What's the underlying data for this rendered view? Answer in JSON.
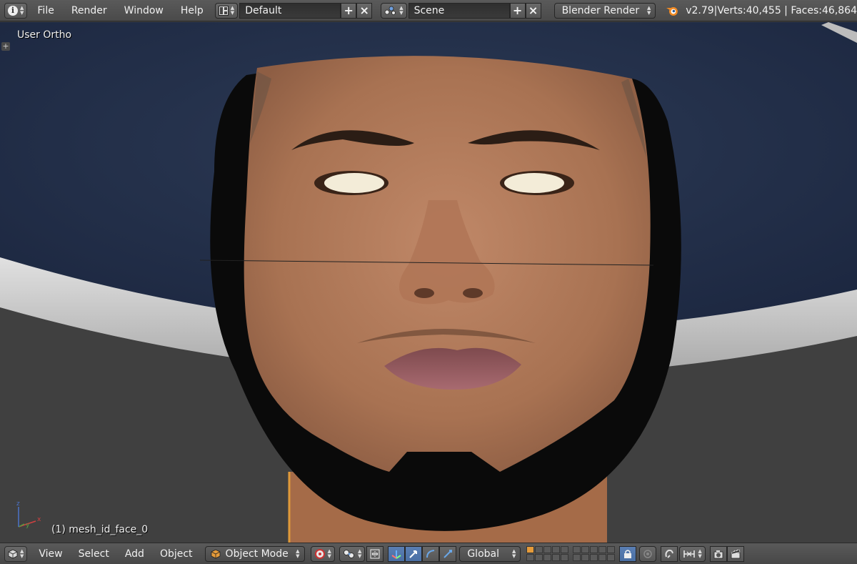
{
  "info_header": {
    "menus": [
      "File",
      "Render",
      "Window",
      "Help"
    ],
    "screen_layout": "Default",
    "scene": "Scene",
    "render_engine": "Blender Render",
    "version": "v2.79",
    "stats": "Verts:40,455 | Faces:46,864"
  },
  "viewport": {
    "view_name": "User Ortho",
    "active_object": "(1) mesh_id_face_0",
    "axes": {
      "x": "x",
      "y": "y",
      "z": "z"
    }
  },
  "view_header": {
    "menus": [
      "View",
      "Select",
      "Add",
      "Object"
    ],
    "mode": "Object Mode",
    "orientation": "Global"
  },
  "colors": {
    "header_bg": "#4f4f4f",
    "hat_navy": "#243149",
    "hat_band": "#c8c8c8",
    "skin": "#b07a5a",
    "active_blue": "#5680c2",
    "orange": "#e5873a"
  },
  "icons": [
    "info-icon",
    "screen-layout-icon",
    "scene-icon",
    "blender-logo-icon",
    "cube-icon",
    "pivot-icon",
    "manipulator-icon",
    "translate-icon",
    "rotate-icon",
    "scale-icon",
    "lock-layer-icon",
    "snap-icon",
    "proportional-icon",
    "render-icon",
    "clapboard-icon"
  ]
}
